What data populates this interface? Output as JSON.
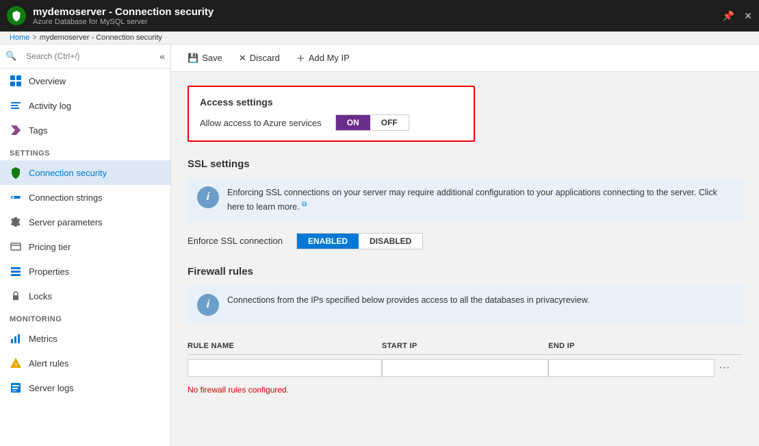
{
  "titleBar": {
    "title": "mydemoserver - Connection security",
    "subtitle": "Azure Database for MySQL server",
    "pinIcon": "📌",
    "closeIcon": "✕"
  },
  "breadcrumb": {
    "home": "Home",
    "separator": ">",
    "current": "mydemoserver - Connection security"
  },
  "sidebar": {
    "searchPlaceholder": "Search (Ctrl+/)",
    "collapseLabel": "«",
    "items": [
      {
        "id": "overview",
        "label": "Overview",
        "icon": "overview"
      },
      {
        "id": "activity-log",
        "label": "Activity log",
        "icon": "activity"
      },
      {
        "id": "tags",
        "label": "Tags",
        "icon": "tags"
      }
    ],
    "settingsSection": "SETTINGS",
    "settingsItems": [
      {
        "id": "connection-security",
        "label": "Connection security",
        "icon": "shield",
        "active": true
      },
      {
        "id": "connection-strings",
        "label": "Connection strings",
        "icon": "connection-strings"
      },
      {
        "id": "server-parameters",
        "label": "Server parameters",
        "icon": "gear"
      },
      {
        "id": "pricing-tier",
        "label": "Pricing tier",
        "icon": "pricing"
      },
      {
        "id": "properties",
        "label": "Properties",
        "icon": "properties"
      },
      {
        "id": "locks",
        "label": "Locks",
        "icon": "lock"
      }
    ],
    "monitoringSection": "MONITORING",
    "monitoringItems": [
      {
        "id": "metrics",
        "label": "Metrics",
        "icon": "metrics"
      },
      {
        "id": "alert-rules",
        "label": "Alert rules",
        "icon": "alert"
      },
      {
        "id": "server-logs",
        "label": "Server logs",
        "icon": "serverlogs"
      }
    ]
  },
  "toolbar": {
    "saveLabel": "Save",
    "discardLabel": "Discard",
    "addMyIpLabel": "Add My IP"
  },
  "accessSettings": {
    "title": "Access settings",
    "allowLabel": "Allow access to Azure services",
    "onLabel": "ON",
    "offLabel": "OFF",
    "activeState": "on"
  },
  "sslSettings": {
    "sectionTitle": "SSL settings",
    "infoText": "Enforcing SSL connections on your server may require additional configuration to your applications connecting to the server. Click here to learn more.",
    "enforceLabel": "Enforce SSL connection",
    "enabledLabel": "ENABLED",
    "disabledLabel": "DISABLED",
    "activeState": "enabled"
  },
  "firewallRules": {
    "sectionTitle": "Firewall rules",
    "infoText": "Connections from the IPs specified below provides access to all the databases in privacyreview.",
    "columns": {
      "ruleName": "RULE NAME",
      "startIp": "START IP",
      "endIp": "END IP"
    },
    "noRulesText": "No firewall rules configured.",
    "ruleNamePlaceholder": "",
    "startIpPlaceholder": "",
    "endIpPlaceholder": ""
  }
}
